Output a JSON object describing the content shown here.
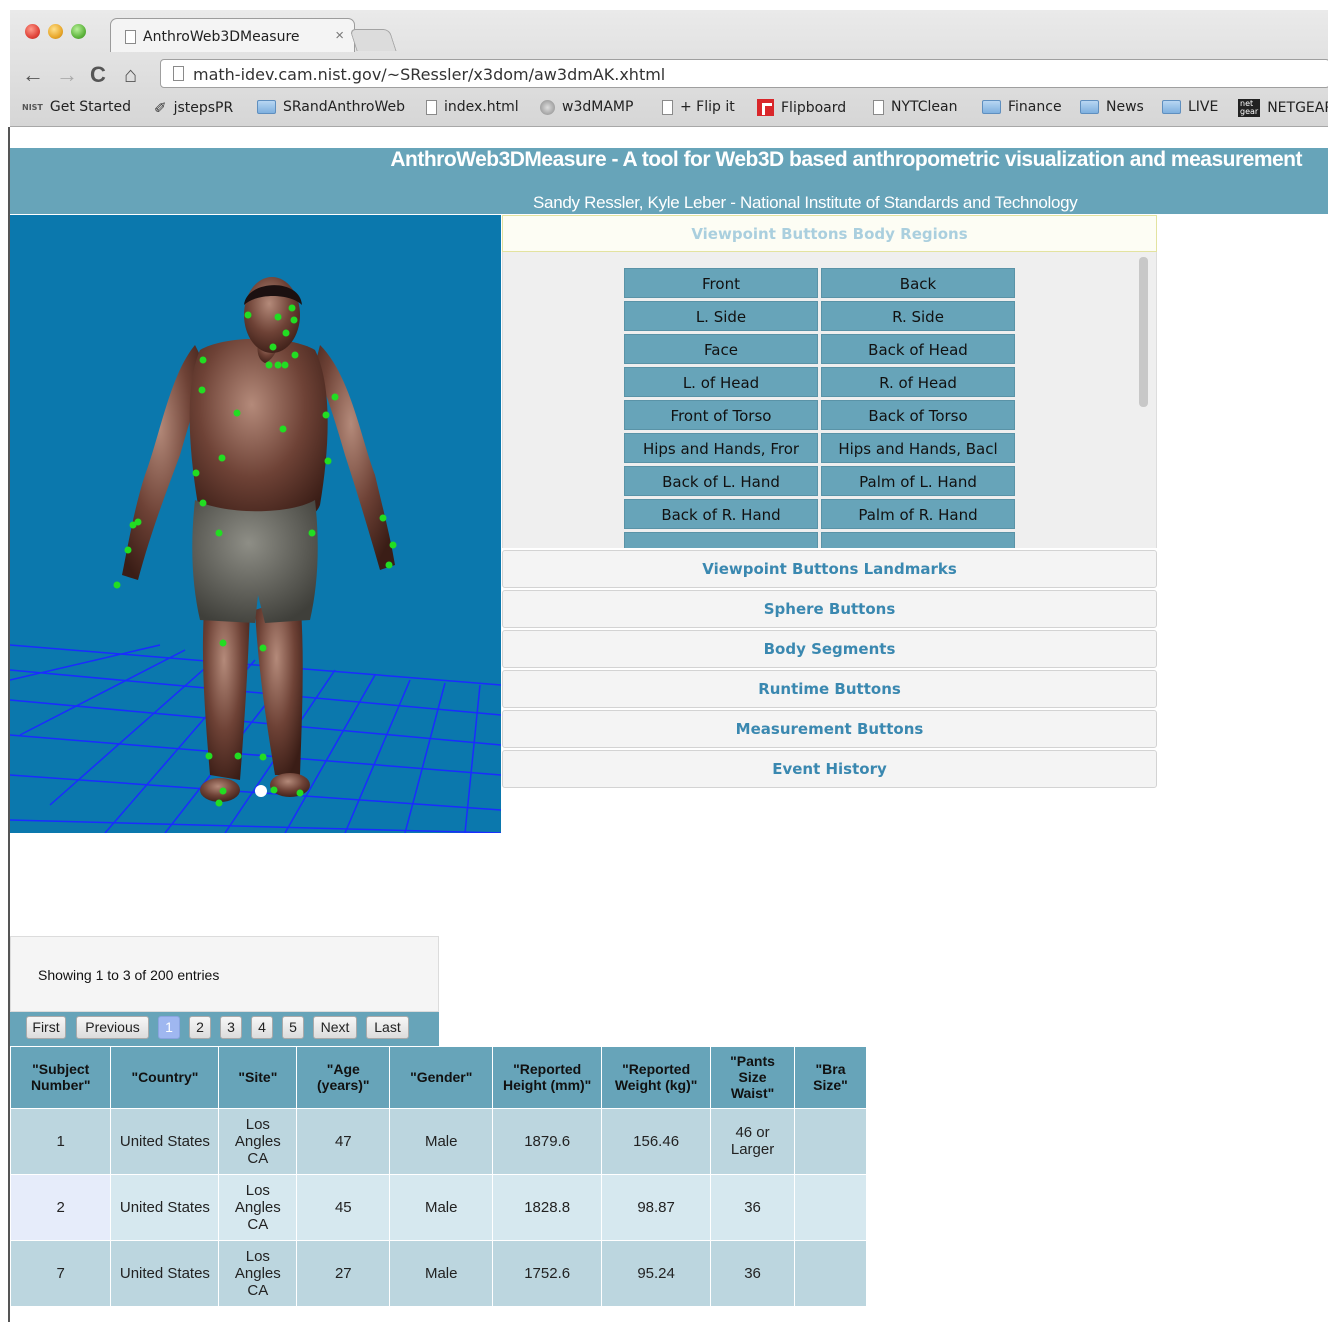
{
  "browser": {
    "tab_title": "AnthroWeb3DMeasure",
    "tab_close": "×",
    "url": "math-idev.cam.nist.gov/~SRessler/x3dom/aw3dmAK.xhtml",
    "nav": {
      "back": "←",
      "forward": "→",
      "reload": "C",
      "home": "⌂"
    },
    "bookmarks": [
      {
        "label": "Get Started",
        "icon": "nist-icon"
      },
      {
        "label": "jstepsPR",
        "icon": "pen-icon"
      },
      {
        "label": "SRandAnthroWeb",
        "icon": "folder-icon"
      },
      {
        "label": "index.html",
        "icon": "page-icon"
      },
      {
        "label": "w3dMAMP",
        "icon": "globe-icon"
      },
      {
        "label": "+ Flip it",
        "icon": "page-icon"
      },
      {
        "label": "Flipboard",
        "icon": "flipboard-icon"
      },
      {
        "label": "NYTClean",
        "icon": "page-icon"
      },
      {
        "label": "Finance",
        "icon": "folder-icon"
      },
      {
        "label": "News",
        "icon": "folder-icon"
      },
      {
        "label": "LIVE",
        "icon": "folder-icon"
      },
      {
        "label": "NETGEAR",
        "icon": "netgear-icon"
      }
    ]
  },
  "header": {
    "title": "AnthroWeb3DMeasure - A tool for Web3D based anthropometric visualization and measurement",
    "subtitle": "Sandy Ressler, Kyle Leber - National Institute of Standards and Technology"
  },
  "accordion": {
    "open_section": "Viewpoint Buttons Body Regions",
    "region_buttons": [
      "Front",
      "Back",
      "L. Side",
      "R. Side",
      "Face",
      "Back of Head",
      "L. of Head",
      "R. of Head",
      "Front of Torso",
      "Back of Torso",
      "Hips and Hands, Fror",
      "Hips and Hands, Bacl",
      "Back of L. Hand",
      "Palm of L. Hand",
      "Back of R. Hand",
      "Palm of R. Hand",
      "",
      ""
    ],
    "sections": [
      "Viewpoint Buttons Landmarks",
      "Sphere Buttons",
      "Body Segments",
      "Runtime Buttons",
      "Measurement Buttons",
      "Event History"
    ]
  },
  "table_info": "Showing 1 to 3 of 200 entries",
  "pagination": {
    "first": "First",
    "previous": "Previous",
    "pages": [
      "1",
      "2",
      "3",
      "4",
      "5"
    ],
    "current_page": "1",
    "next": "Next",
    "last": "Last"
  },
  "table": {
    "columns": [
      "\"Subject Number\"",
      "\"Country\"",
      "\"Site\"",
      "\"Age (years)\"",
      "\"Gender\"",
      "\"Reported Height (mm)\"",
      "\"Reported Weight (kg)\"",
      "\"Pants Size Waist\"",
      "\"Bra Size\""
    ],
    "rows": [
      [
        "1",
        "United States",
        "Los Angles CA",
        "47",
        "Male",
        "1879.6",
        "156.46",
        "46 or Larger",
        ""
      ],
      [
        "2",
        "United States",
        "Los Angles CA",
        "45",
        "Male",
        "1828.8",
        "98.87",
        "36",
        ""
      ],
      [
        "7",
        "United States",
        "Los Angles CA",
        "27",
        "Male",
        "1752.6",
        "95.24",
        "36",
        ""
      ]
    ]
  },
  "colors": {
    "header_bg": "#67a4b9",
    "viewport_bg": "#0b78ad",
    "grid_line": "#1a2cff",
    "landmark": "#22dd22",
    "accordion_text": "#3a88b0"
  }
}
